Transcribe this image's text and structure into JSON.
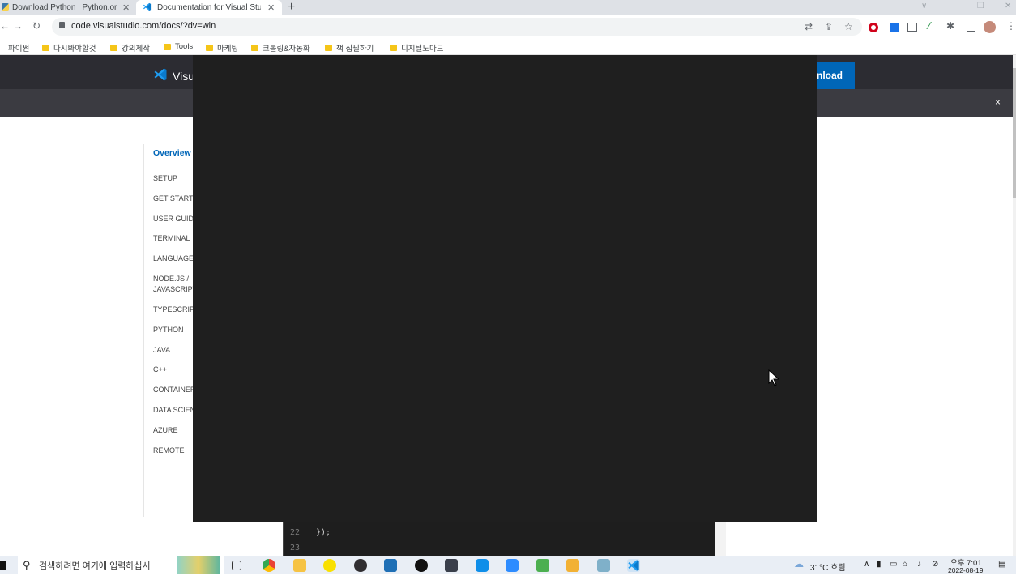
{
  "browser": {
    "tabs": [
      {
        "title": "Download Python | Python.org",
        "icon": "python-icon"
      },
      {
        "title": "Documentation for Visual Studio",
        "icon": "vscode-icon"
      }
    ],
    "url": "code.visualstudio.com/docs/?dv=win",
    "bookmarks": [
      "파이썬",
      "다시봐야할것",
      "강의제작",
      "Tools",
      "마케팅",
      "크롤링&자동화",
      "책 집필하기",
      "디지털노마드"
    ]
  },
  "page": {
    "header_logo": "Visu",
    "download_label": "nload",
    "banner_close": "×",
    "sidebar": {
      "overview": "Overview",
      "items": [
        "SETUP",
        "GET STARTED",
        "USER GUIDE",
        "TERMINAL",
        "LANGUAGES",
        "NODE.JS / JAVASCRIPT",
        "TYPESCRIPT",
        "PYTHON",
        "JAVA",
        "C++",
        "CONTAINERS",
        "DATA SCIENCE",
        "AZURE",
        "REMOTE"
      ]
    },
    "code": {
      "lines": [
        {
          "num": "22",
          "text": "});"
        },
        {
          "num": "23",
          "text": ""
        }
      ]
    }
  },
  "taskbar": {
    "search_placeholder": "검색하려면 여기에 입력하십시",
    "weather": "31°C 흐림",
    "time": "오후 7:01",
    "date": "2022-08-19"
  },
  "colors": {
    "accent": "#0066b8",
    "header_bg": "#2c2c32",
    "modal_bg": "#1f1f1f",
    "code_bg": "#1e1e1e"
  }
}
